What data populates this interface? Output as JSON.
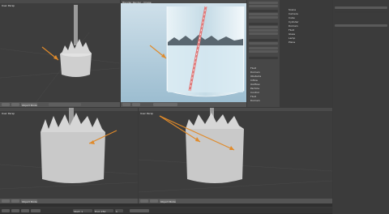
{
  "viewports": {
    "top_left": {
      "label": "User Persp",
      "footer_mode": "Object Mode"
    },
    "render": {
      "title_bar": "Blender Render - Image"
    },
    "bottom_left": {
      "label": "User Persp",
      "footer_mode": "Object Mode"
    },
    "bottom_right": {
      "label": "User Persp",
      "footer_mode": "Object Mode"
    }
  },
  "properties_panel": {
    "tools": [
      "Fluid",
      "Domain",
      "Obstacle",
      "Inflow",
      "Outflow",
      "Particle",
      "Control",
      "Fluid",
      "Domain"
    ]
  },
  "outliner": {
    "items": [
      "Scene",
      "Camera",
      "Cube",
      "Cylinder",
      "Domain",
      "Fluid",
      "Glass",
      "Lamp",
      "Plane"
    ]
  },
  "timeline": {
    "start_label": "Start: 1",
    "end_label": "End: 250",
    "frame_label": "1"
  },
  "colors": {
    "arrow": "#e08a2a",
    "bg": "#393939",
    "viewport": "#3d3d3d",
    "render_bg": "#bcd3e0"
  }
}
